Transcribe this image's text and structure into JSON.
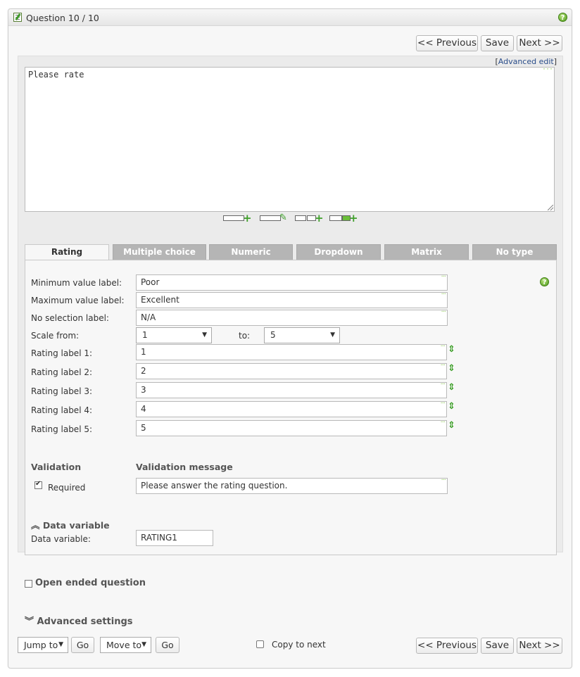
{
  "header": {
    "title": "Question 10 / 10",
    "help_icon": "?"
  },
  "nav": {
    "previous": "<< Previous",
    "save": "Save",
    "next": "Next >>"
  },
  "editor": {
    "advanced_edit": "Advanced edit",
    "question_text": "Please rate"
  },
  "tabs": [
    {
      "label": "Rating"
    },
    {
      "label": "Multiple choice"
    },
    {
      "label": "Numeric"
    },
    {
      "label": "Dropdown"
    },
    {
      "label": "Matrix"
    },
    {
      "label": "No type"
    }
  ],
  "rating": {
    "min_label": {
      "label": "Minimum value label:",
      "value": "Poor"
    },
    "max_label": {
      "label": "Maximum value label:",
      "value": "Excellent"
    },
    "no_sel_label": {
      "label": "No selection label:",
      "value": "N/A"
    },
    "scale": {
      "label": "Scale from:",
      "from": "1",
      "to_label": "to:",
      "to": "5"
    },
    "labels": [
      {
        "label": "Rating label 1:",
        "value": "1"
      },
      {
        "label": "Rating label 2:",
        "value": "2"
      },
      {
        "label": "Rating label 3:",
        "value": "3"
      },
      {
        "label": "Rating label 4:",
        "value": "4"
      },
      {
        "label": "Rating label 5:",
        "value": "5"
      }
    ]
  },
  "validation": {
    "heading": "Validation",
    "message_heading": "Validation message",
    "required_label": "Required",
    "required_checked": true,
    "message": "Please answer the rating question."
  },
  "data_variable": {
    "heading": "Data variable",
    "label": "Data variable:",
    "value": "RATING1"
  },
  "open_ended": {
    "label": "Open ended question"
  },
  "advanced": {
    "label": "Advanced settings"
  },
  "footer": {
    "jump_to": "Jump to",
    "go": "Go",
    "move_to": "Move to",
    "copy_to_next": "Copy to next"
  }
}
